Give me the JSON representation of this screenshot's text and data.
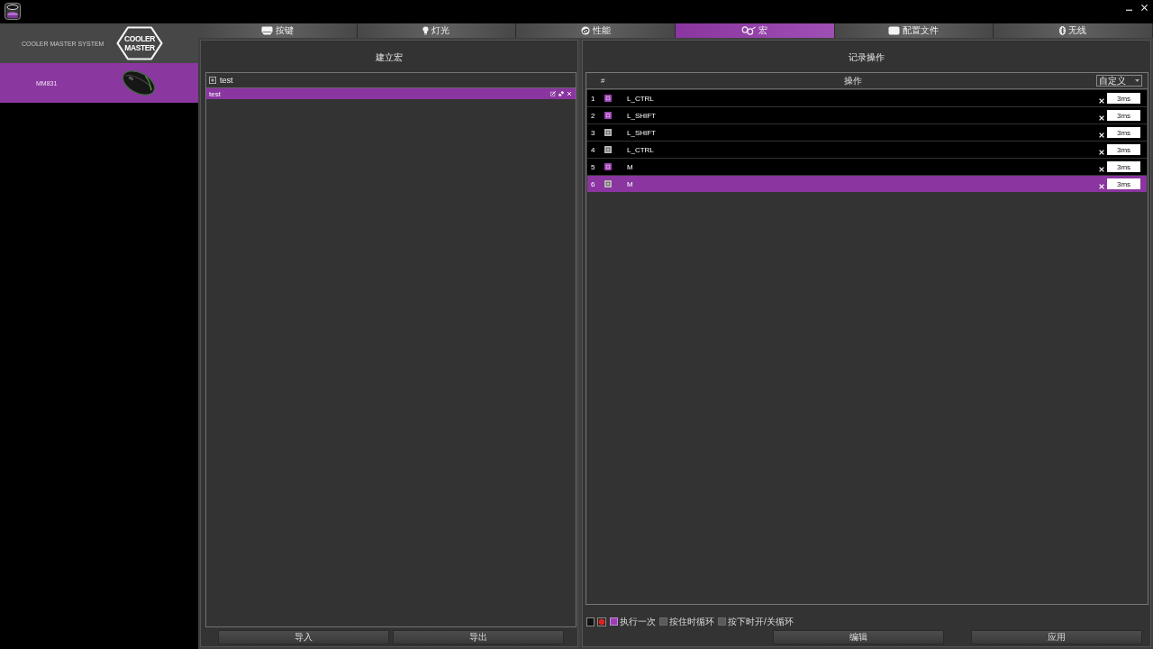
{
  "sidebar": {
    "brand": "COOLER MASTER SYSTEM",
    "logo": [
      "COOLER",
      "MASTER"
    ],
    "devices": [
      {
        "name": "MM831",
        "selected": true
      }
    ]
  },
  "tabs": [
    {
      "label": "按键",
      "selected": false
    },
    {
      "label": "灯光",
      "selected": false
    },
    {
      "label": "性能",
      "selected": false
    },
    {
      "label": "宏",
      "selected": true
    },
    {
      "label": "配置文件",
      "selected": false
    },
    {
      "label": "无线",
      "selected": false
    }
  ],
  "macro_panel": {
    "title": "建立宏",
    "group": {
      "label": "test"
    },
    "macros": [
      {
        "name": "test",
        "selected": true
      }
    ],
    "buttons": [
      "导入",
      "导出"
    ]
  },
  "record_panel": {
    "title": "记录操作",
    "columns": [
      "#",
      "操作"
    ],
    "delay_mode": "自定义",
    "steps": [
      {
        "number": "1",
        "kind": "down",
        "key": "L_CTRL",
        "delay": "3ms",
        "selected": false
      },
      {
        "number": "2",
        "kind": "down",
        "key": "L_SHIFT",
        "delay": "3ms",
        "selected": false
      },
      {
        "number": "3",
        "kind": "up",
        "key": "L_SHIFT",
        "delay": "3ms",
        "selected": false
      },
      {
        "number": "4",
        "kind": "up",
        "key": "L_CTRL",
        "delay": "3ms",
        "selected": false
      },
      {
        "number": "5",
        "kind": "down",
        "key": "M",
        "delay": "3ms",
        "selected": false
      },
      {
        "number": "6",
        "kind": "up",
        "key": "M",
        "delay": "3ms",
        "selected": true
      }
    ],
    "playback_modes": [
      {
        "label": "执行一次",
        "selected": true
      },
      {
        "label": "按住时循环",
        "selected": false
      },
      {
        "label": "按下时开/关循环",
        "selected": false
      }
    ],
    "buttons": [
      "编辑",
      "应用"
    ]
  }
}
